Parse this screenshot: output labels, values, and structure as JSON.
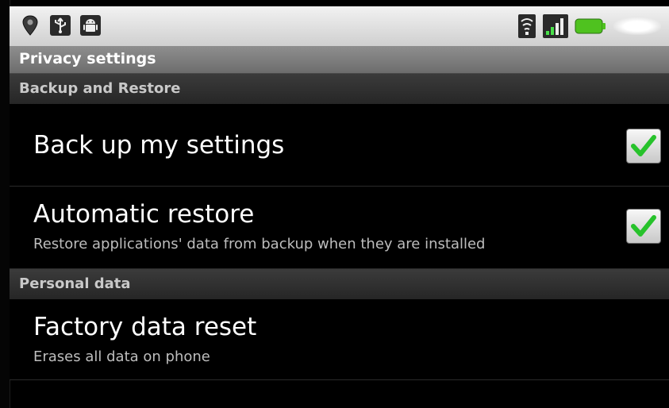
{
  "title_bar": {
    "title": "Privacy settings"
  },
  "status_bar": {
    "left_icons": [
      "location-pin-icon",
      "usb-icon",
      "android-icon"
    ],
    "right_icons": [
      "wifi-icon",
      "signal-icon",
      "battery-icon"
    ]
  },
  "sections": [
    {
      "header": "Backup and Restore",
      "items": [
        {
          "title": "Back up my settings",
          "summary": "",
          "checked": true
        },
        {
          "title": "Automatic restore",
          "summary": "Restore applications' data from backup when they are installed",
          "checked": true
        }
      ]
    },
    {
      "header": "Personal data",
      "items": [
        {
          "title": "Factory data reset",
          "summary": "Erases all data on phone"
        }
      ]
    }
  ],
  "colors": {
    "check_green": "#27c22b",
    "section_header_text": "#c9c9c9",
    "title_bar": "#7c7c7c"
  }
}
